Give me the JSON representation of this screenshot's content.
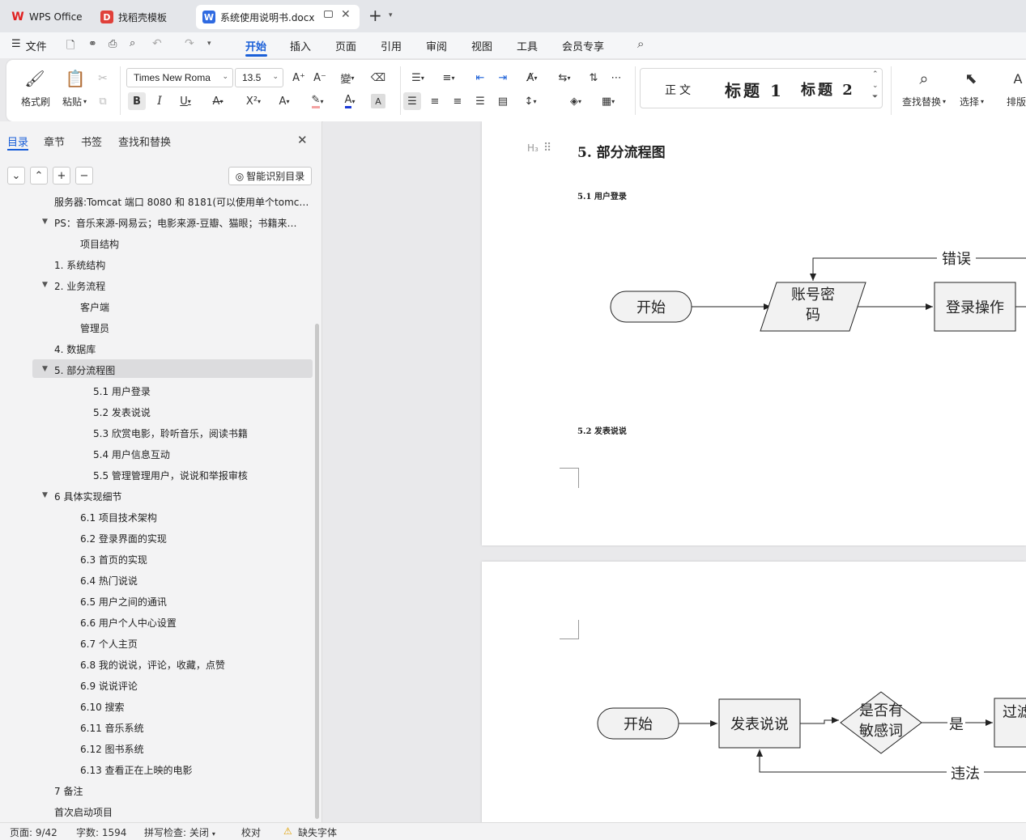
{
  "tabs": {
    "wps": "WPS Office",
    "template": "找稻壳模板",
    "doc": "系统使用说明书.docx"
  },
  "menu": {
    "file": "文件",
    "items": [
      "开始",
      "插入",
      "页面",
      "引用",
      "审阅",
      "视图",
      "工具",
      "会员专享"
    ]
  },
  "toolbar": {
    "format_painter": "格式刷",
    "paste": "粘贴",
    "font": "Times New Roma",
    "size": "13.5",
    "style_normal": "正文",
    "style_h1": "标题 1",
    "style_h2": "标题 2",
    "find_replace": "查找替换",
    "select": "选择",
    "layout": "排版"
  },
  "nav": {
    "tabs": [
      "目录",
      "章节",
      "书签",
      "查找和替换"
    ],
    "smart_toc": "智能识别目录",
    "items": [
      "服务器:Tomcat 端口 8080 和 8181(可以使用单个tomc…",
      "PS：音乐来源-网易云；电影来源-豆瓣、猫眼；书籍来…",
      "项目结构",
      "1. 系统结构",
      "2. 业务流程",
      "客户端",
      "管理员",
      "4. 数据库",
      "5. 部分流程图",
      "5.1 用户登录",
      "5.2 发表说说",
      "5.3 欣赏电影，聆听音乐，阅读书籍",
      "5.4 用户信息互动",
      "5.5 管理管理用户，说说和举报审核",
      "6 具体实现细节",
      "6.1 项目技术架构",
      "6.2 登录界面的实现",
      "6.3 首页的实现",
      "6.4 热门说说",
      "6.5 用户之间的通讯",
      "6.6 用户个人中心设置",
      "6.7 个人主页",
      "6.8 我的说说，评论，收藏，点赞",
      "6.9 说说评论",
      "6.10 搜索",
      "6.11 音乐系统",
      "6.12 图书系统",
      "6.13 查看正在上映的电影",
      "7 备注",
      "首次启动项目"
    ]
  },
  "doc": {
    "heading_marker": "H₃",
    "heading": "5. 部分流程图",
    "sub1": "5.1 用户登录",
    "sub2": "5.2 发表说说",
    "flow1": {
      "start": "开始",
      "account": "账号密码",
      "login": "登录操作",
      "error": "错误"
    },
    "flow2": {
      "start": "开始",
      "post": "发表说说",
      "sensitive": "是否有敏感词",
      "yes": "是",
      "filter": "过滤",
      "illegal": "违法"
    }
  },
  "status": {
    "page": "页面: 9/42",
    "words": "字数: 1594",
    "spell": "拼写检查: 关闭",
    "proof": "校对",
    "missing_font": "缺失字体"
  }
}
